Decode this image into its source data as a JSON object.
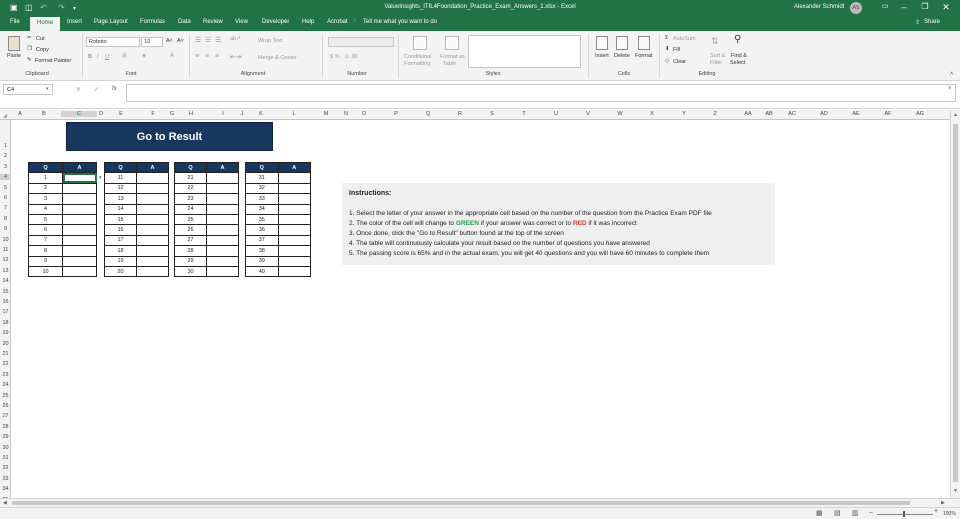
{
  "window": {
    "title": "ValueInsights_ITIL4Foundation_Practice_Exam_Answers_1.xlsx  -  Excel",
    "user": "Alexander Schmidt",
    "avatar_initials": "AS"
  },
  "tabs": [
    "File",
    "Home",
    "Insert",
    "Page Layout",
    "Formulas",
    "Data",
    "Review",
    "View",
    "Developer",
    "Help",
    "Acrobat"
  ],
  "tell_me": "Tell me what you want to do",
  "share": "Share",
  "ribbon": {
    "clipboard": {
      "paste": "Paste",
      "cut": "Cut",
      "copy": "Copy",
      "format_painter": "Format Painter",
      "label": "Clipboard"
    },
    "font": {
      "name": "Roboto",
      "size": "10",
      "label": "Font"
    },
    "alignment": {
      "wrap": "Wrap Text",
      "merge": "Merge & Center",
      "label": "Alignment"
    },
    "number": {
      "label": "Number"
    },
    "styles": {
      "conditional": "Conditional",
      "conditional2": "Formatting",
      "format_as": "Format as",
      "format_as2": "Table",
      "label": "Styles"
    },
    "cells": {
      "insert": "Insert",
      "delete": "Delete",
      "format": "Format",
      "label": "Cells"
    },
    "editing": {
      "autosum": "AutoSum",
      "fill": "Fill",
      "clear": "Clear",
      "sort": "Sort &",
      "sort2": "Filter",
      "find": "Find &",
      "find2": "Select",
      "label": "Editing"
    }
  },
  "formula_bar": {
    "name_box": "C4",
    "fx": "fx",
    "cancel": "✕",
    "enter": "✓"
  },
  "columns": [
    "A",
    "B",
    "C",
    "D",
    "E",
    "F",
    "G",
    "H",
    "I",
    "J",
    "K",
    "L",
    "M",
    "N",
    "O",
    "P",
    "Q",
    "R",
    "S",
    "T",
    "U",
    "V",
    "W",
    "X",
    "Y",
    "Z",
    "AA",
    "AB",
    "AC",
    "AD",
    "AE",
    "AF",
    "AG"
  ],
  "rows": [
    "1",
    "2",
    "3",
    "4",
    "5",
    "6",
    "7",
    "8",
    "9",
    "10",
    "11",
    "12",
    "13",
    "14",
    "15",
    "16",
    "17",
    "18",
    "19",
    "20",
    "21",
    "22",
    "23",
    "24",
    "25",
    "26",
    "27",
    "28",
    "29",
    "30",
    "31",
    "32",
    "33",
    "34",
    "35"
  ],
  "button": "Go to Result",
  "table_headers": {
    "q": "Q",
    "a": "A"
  },
  "tables": [
    [
      "1",
      "2",
      "3",
      "4",
      "5",
      "6",
      "7",
      "8",
      "9",
      "10"
    ],
    [
      "11",
      "12",
      "13",
      "14",
      "15",
      "16",
      "17",
      "18",
      "19",
      "20"
    ],
    [
      "21",
      "22",
      "23",
      "24",
      "25",
      "26",
      "27",
      "28",
      "29",
      "30"
    ],
    [
      "31",
      "32",
      "33",
      "34",
      "35",
      "36",
      "37",
      "38",
      "39",
      "40"
    ]
  ],
  "instructions": {
    "title": "Instructions:",
    "line1": "1. Select the letter of your answer in the appropriate cell based on the number of the question from the Practice Exam PDF file",
    "line2a": "2. The color of the cell will change to ",
    "line2b": "GREEN",
    "line2c": " if your answer was correct or to ",
    "line2d": "RED",
    "line2e": " if it was incorrect",
    "line3": "3. Once done, click the \"Go to Result\" button found at the top of the screen",
    "line4": "4. The table will continuously calculate your result based on the number of questions you have answered",
    "line5": "5. The passing score is 65% and in the actual exam, you will get 40 questions and you will have 60 minutes to complete them"
  },
  "status": {
    "zoom": "100%"
  },
  "colors": {
    "excel_green": "#217346",
    "header_navy": "#17375e",
    "green_text": "#2e9e4a",
    "red_text": "#d0402a"
  }
}
